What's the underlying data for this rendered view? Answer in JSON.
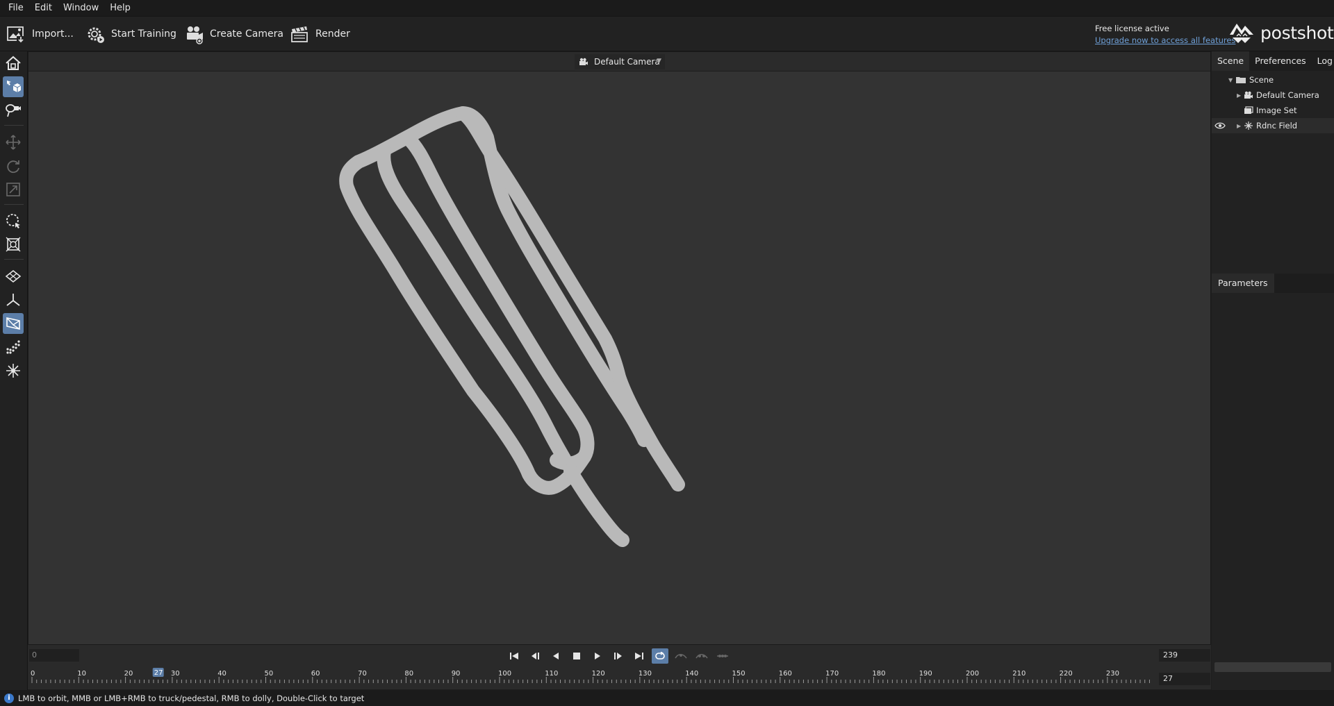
{
  "menu": [
    "File",
    "Edit",
    "Window",
    "Help"
  ],
  "toolbar": {
    "import": "Import...",
    "start_training": "Start Training",
    "create_camera": "Create Camera",
    "render": "Render"
  },
  "license": {
    "status": "Free license active",
    "upgrade_link": "Upgrade now to access all features"
  },
  "brand": "postshot",
  "viewport": {
    "camera_select": "Default Camera"
  },
  "timeline": {
    "start_frame": "0",
    "end_frame": "239",
    "current_frame": "27",
    "loop_enabled": true,
    "ticks": [
      "0",
      "10",
      "20",
      "30",
      "40",
      "50",
      "60",
      "70",
      "80",
      "90",
      "100",
      "110",
      "120",
      "130",
      "140",
      "150",
      "160",
      "170",
      "180",
      "190",
      "200",
      "210",
      "220",
      "230"
    ]
  },
  "right_panel": {
    "tabs": [
      "Scene",
      "Preferences",
      "Log"
    ],
    "tree": [
      {
        "label": "Scene",
        "expanded": true
      },
      {
        "label": "Default Camera",
        "expanded": false
      },
      {
        "label": "Image Set"
      },
      {
        "label": "Rdnc Field",
        "expanded": false
      }
    ],
    "parameters_tab": "Parameters"
  },
  "status": {
    "hint": "LMB to orbit, MMB or LMB+RMB to truck/pedestal, RMB to dolly, Double-Click to target"
  },
  "colors": {
    "accent": "#5c7ea8",
    "viewport_bg": "#333333",
    "point_cloud": "#b9b9b9",
    "link": "#6fa0d8"
  }
}
